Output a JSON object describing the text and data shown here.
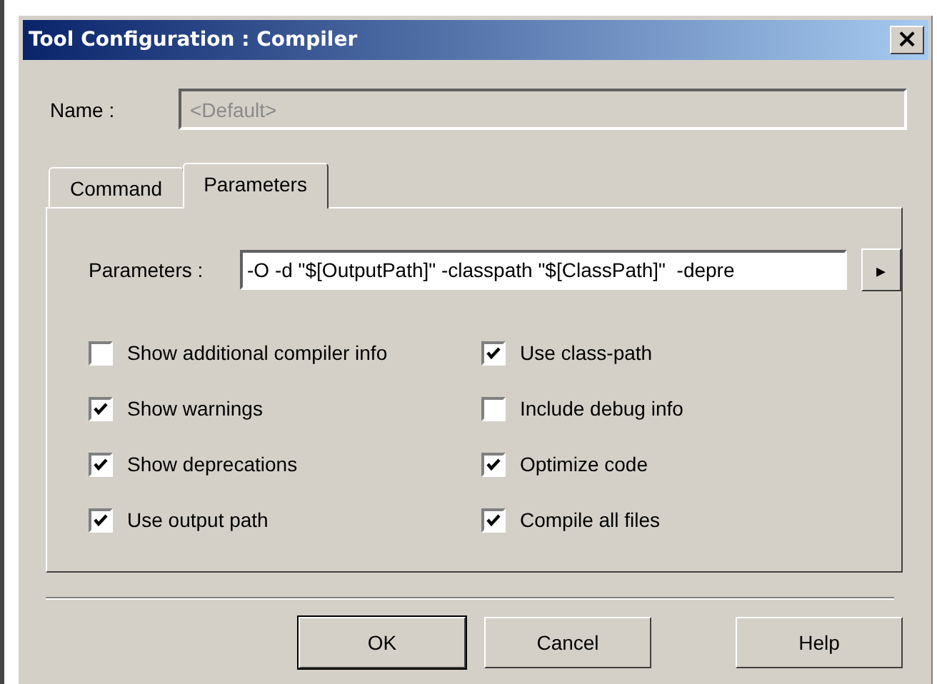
{
  "window": {
    "title": "Tool Configuration : Compiler",
    "close": "×"
  },
  "name": {
    "label": "Name :",
    "value": "<Default>",
    "disabled": true
  },
  "tabs": [
    {
      "label": "Command",
      "selected": false
    },
    {
      "label": "Parameters",
      "selected": true
    }
  ],
  "parameters": {
    "label": "Parameters :",
    "value": "-O -d \"$[OutputPath]\" -classpath \"$[ClassPath]\"  -depre",
    "arrow": "▸"
  },
  "options": [
    {
      "label": "Show additional compiler info",
      "checked": false
    },
    {
      "label": "Use class-path",
      "checked": true
    },
    {
      "label": "Show warnings",
      "checked": true
    },
    {
      "label": "Include debug info",
      "checked": false
    },
    {
      "label": "Show deprecations",
      "checked": true
    },
    {
      "label": "Optimize code",
      "checked": true
    },
    {
      "label": "Use output path",
      "checked": true
    },
    {
      "label": "Compile all files",
      "checked": true
    }
  ],
  "buttons": [
    {
      "label": "OK",
      "default": true
    },
    {
      "label": "Cancel",
      "default": false
    },
    {
      "label": "Help",
      "default": false
    }
  ]
}
